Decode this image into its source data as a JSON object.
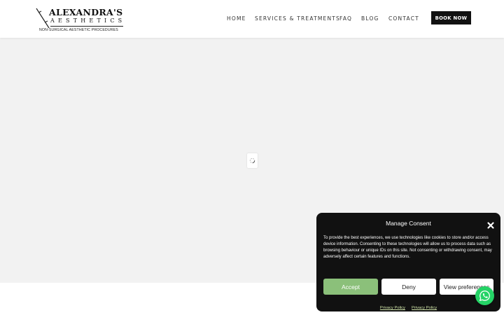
{
  "header": {
    "logo": {
      "title": "ALEXANDRA'S",
      "subtitle": "AESTHETICS",
      "tagline": "NON-SURGICAL AESTHETIC PROCEDURES"
    },
    "nav": [
      {
        "label": "HOME"
      },
      {
        "label": "SERVICES & TREATMENTS"
      },
      {
        "label": "FAQ"
      },
      {
        "label": "BLOG"
      },
      {
        "label": "CONTACT"
      }
    ],
    "book_label": "BOOK NOW"
  },
  "main": {
    "loader_icon": "loading-spinner-icon"
  },
  "consent": {
    "title": "Manage Consent",
    "close_icon": "close-icon",
    "text": "To provide the best experiences, we use technologies like cookies to store and/or access device information. Consenting to these technologies will allow us to process data such as browsing behaviour or unique IDs on this site. Not consenting or withdrawing consent, may adversely affect certain features and functions.",
    "accept_label": "Accept",
    "deny_label": "Deny",
    "preferences_label": "View preferences",
    "links": [
      "Privacy Policy",
      "Privacy Policy"
    ]
  },
  "whatsapp": {
    "icon": "whatsapp-icon"
  },
  "colors": {
    "accent_green": "#8bc07a",
    "modal_bg": "#111111",
    "whatsapp_green": "#25d366",
    "button_dark": "#111111"
  }
}
